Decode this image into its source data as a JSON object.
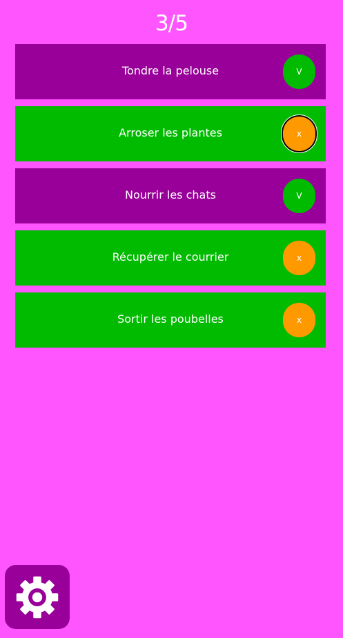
{
  "header": {
    "counter": "3/5"
  },
  "tasks": [
    {
      "label": "Tondre la pelouse",
      "status": "done",
      "toggle_label": "V"
    },
    {
      "label": "Arroser les plantes",
      "status": "todo",
      "toggle_label": "x"
    },
    {
      "label": "Nourrir les chats",
      "status": "done",
      "toggle_label": "V"
    },
    {
      "label": "Récupérer le courrier",
      "status": "todo",
      "toggle_label": "x"
    },
    {
      "label": "Sortir les poubelles",
      "status": "todo",
      "toggle_label": "x"
    }
  ],
  "settings": {
    "icon": "gear-icon"
  },
  "colors": {
    "background": "#ff55ff",
    "done_row": "#990099",
    "todo_row": "#00bb00",
    "done_toggle": "#00bb00",
    "todo_toggle": "#ff9900",
    "settings_button": "#990099"
  }
}
